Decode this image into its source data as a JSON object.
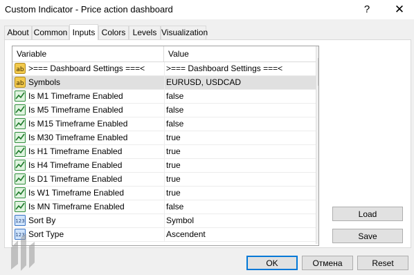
{
  "window": {
    "title": "Custom Indicator - Price action dashboard",
    "help_glyph": "?",
    "close_glyph": "✕"
  },
  "tabs": [
    {
      "label": "About"
    },
    {
      "label": "Common"
    },
    {
      "label": "Inputs"
    },
    {
      "label": "Colors"
    },
    {
      "label": "Levels"
    },
    {
      "label": "Visualization"
    }
  ],
  "grid": {
    "headers": {
      "variable": "Variable",
      "value": "Value"
    },
    "rows": [
      {
        "icon": "ab-string-icon",
        "variable": ">=== Dashboard Settings ===<",
        "value": ">=== Dashboard Settings ===<"
      },
      {
        "icon": "ab-string-icon",
        "variable": "Symbols",
        "value": "EURUSD, USDCAD"
      },
      {
        "icon": "bool-icon",
        "variable": "Is M1 Timeframe Enabled",
        "value": "false"
      },
      {
        "icon": "bool-icon",
        "variable": "Is M5 Timeframe Enabled",
        "value": "false"
      },
      {
        "icon": "bool-icon",
        "variable": "Is M15 Timeframe Enabled",
        "value": "false"
      },
      {
        "icon": "bool-icon",
        "variable": "Is M30 Timeframe Enabled",
        "value": "true"
      },
      {
        "icon": "bool-icon",
        "variable": "Is H1 Timeframe Enabled",
        "value": "true"
      },
      {
        "icon": "bool-icon",
        "variable": "Is H4 Timeframe Enabled",
        "value": "true"
      },
      {
        "icon": "bool-icon",
        "variable": "Is D1 Timeframe Enabled",
        "value": "true"
      },
      {
        "icon": "bool-icon",
        "variable": "Is W1 Timeframe Enabled",
        "value": "true"
      },
      {
        "icon": "bool-icon",
        "variable": "Is MN Timeframe Enabled",
        "value": "false"
      },
      {
        "icon": "enum-123-icon",
        "variable": "Sort By",
        "value": "Symbol"
      },
      {
        "icon": "enum-123-icon",
        "variable": "Sort Type",
        "value": "Ascendent"
      }
    ]
  },
  "side_buttons": {
    "load": "Load",
    "save": "Save"
  },
  "footer_buttons": {
    "ok": "OK",
    "cancel": "Отмена",
    "reset": "Reset"
  },
  "colors": {
    "accent": "#0078d7",
    "selected_row": "#e0e0e0"
  }
}
